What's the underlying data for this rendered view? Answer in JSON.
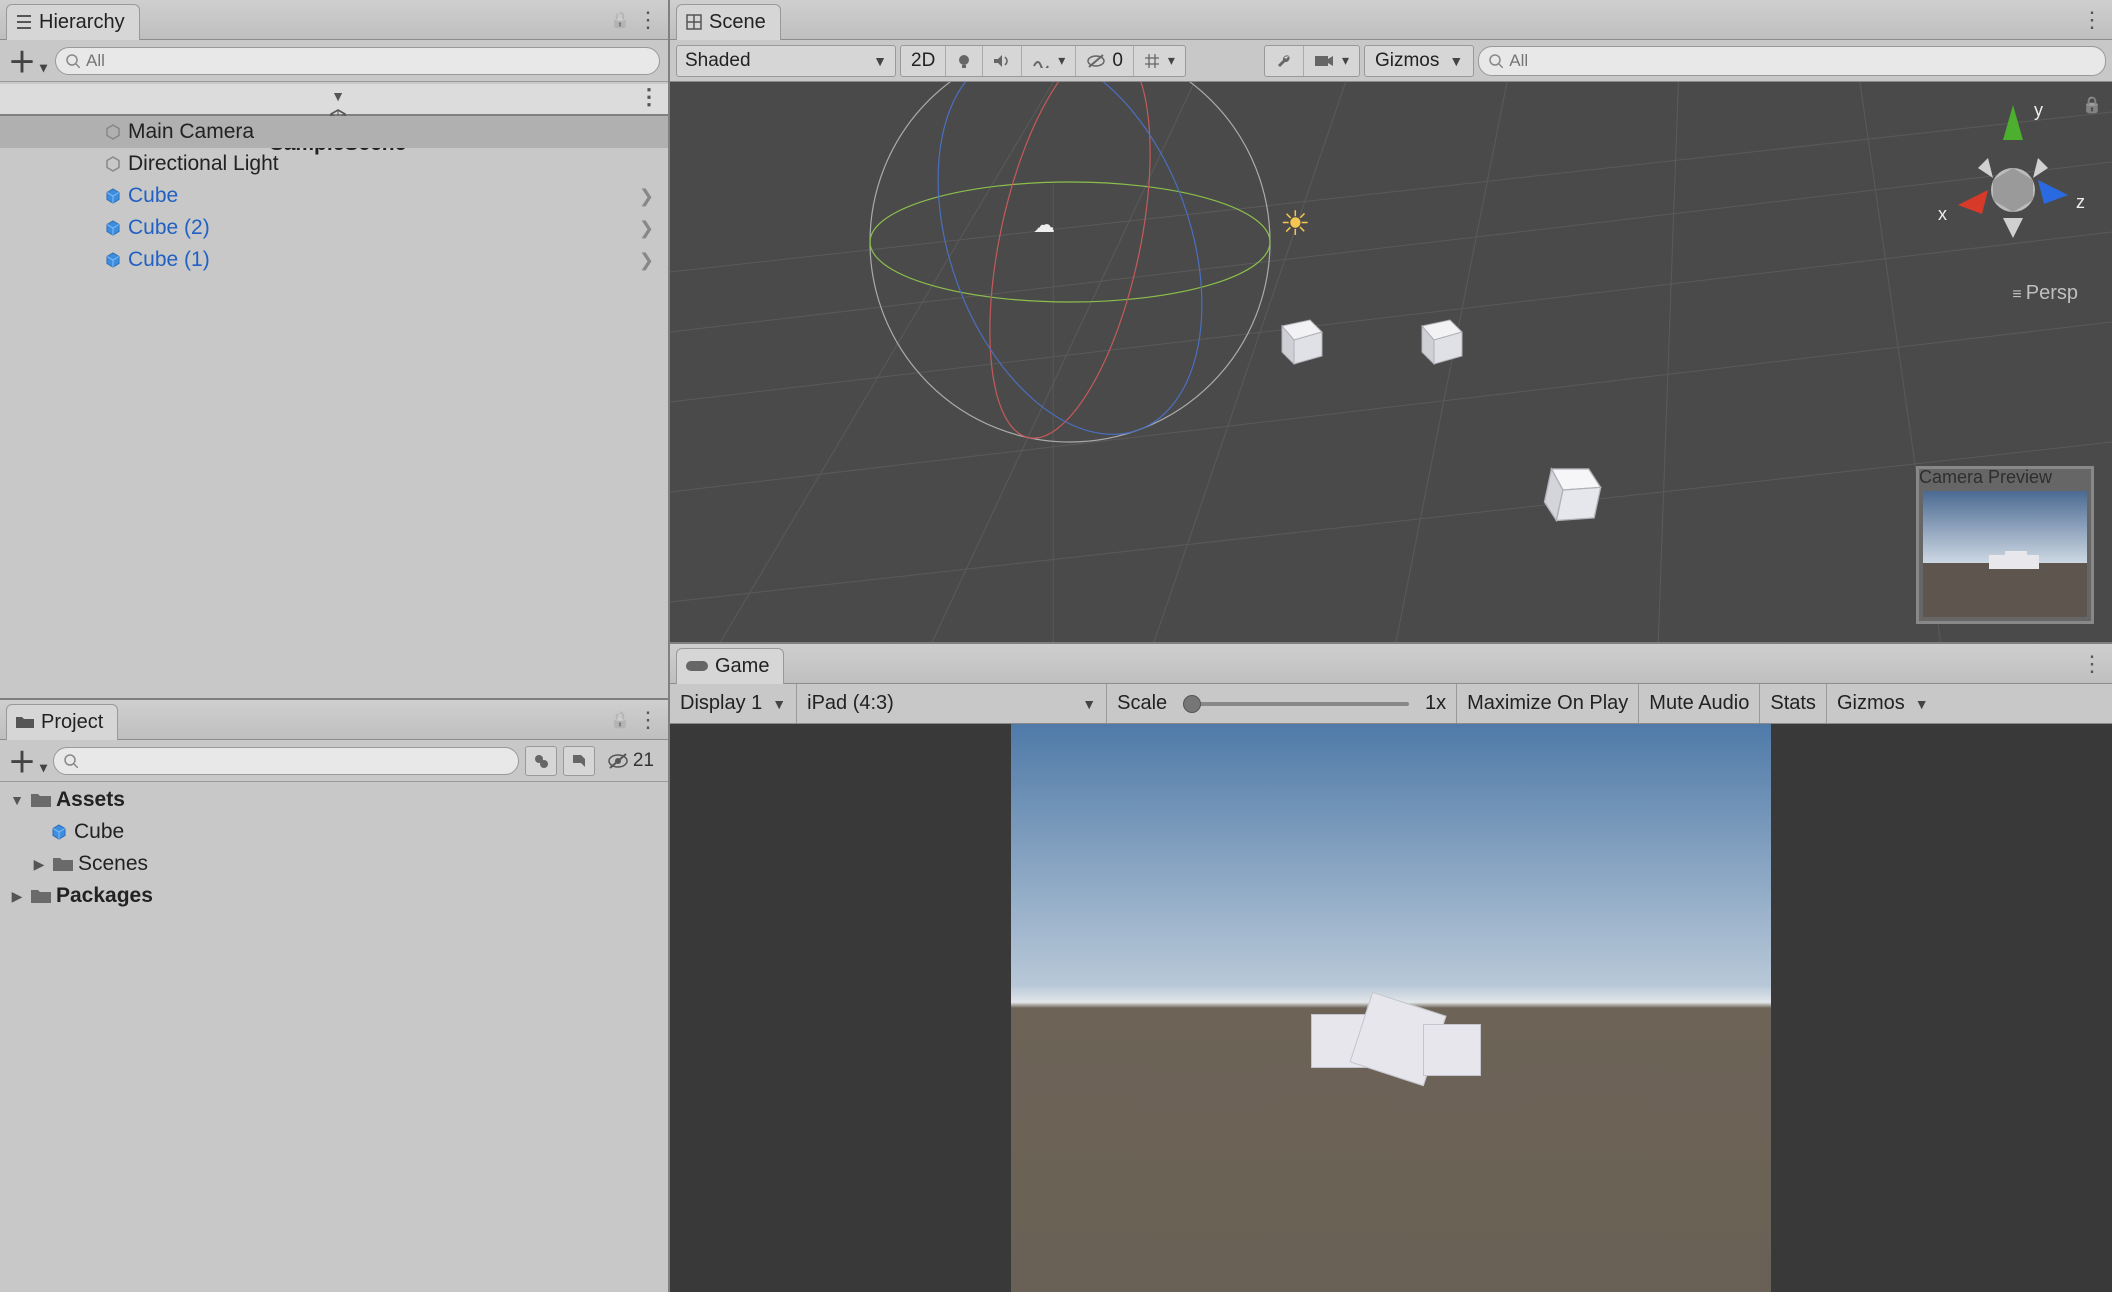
{
  "hierarchy": {
    "tab_label": "Hierarchy",
    "search_placeholder": "All",
    "scene_name": "SampleScene",
    "items": [
      {
        "label": "Main Camera",
        "prefab": false,
        "expand": false,
        "selected": true
      },
      {
        "label": "Directional Light",
        "prefab": false,
        "expand": false,
        "selected": false
      },
      {
        "label": "Cube",
        "prefab": true,
        "expand": true,
        "selected": false
      },
      {
        "label": "Cube (2)",
        "prefab": true,
        "expand": true,
        "selected": false
      },
      {
        "label": "Cube (1)",
        "prefab": true,
        "expand": true,
        "selected": false
      }
    ]
  },
  "project": {
    "tab_label": "Project",
    "search_placeholder": "",
    "hidden_count": "21",
    "tree": {
      "assets_label": "Assets",
      "cube_label": "Cube",
      "scenes_label": "Scenes",
      "packages_label": "Packages"
    }
  },
  "scene": {
    "tab_label": "Scene",
    "shading_mode": "Shaded",
    "btn_2d": "2D",
    "hidden_badge": "0",
    "gizmos_label": "Gizmos",
    "search_placeholder": "All",
    "axes": {
      "x": "x",
      "y": "y",
      "z": "z"
    },
    "projection": "Persp",
    "camera_preview_label": "Camera Preview"
  },
  "game": {
    "tab_label": "Game",
    "display": "Display 1",
    "aspect": "iPad (4:3)",
    "scale_label": "Scale",
    "scale_value": "1x",
    "maximize": "Maximize On Play",
    "mute": "Mute Audio",
    "stats": "Stats",
    "gizmos": "Gizmos"
  }
}
